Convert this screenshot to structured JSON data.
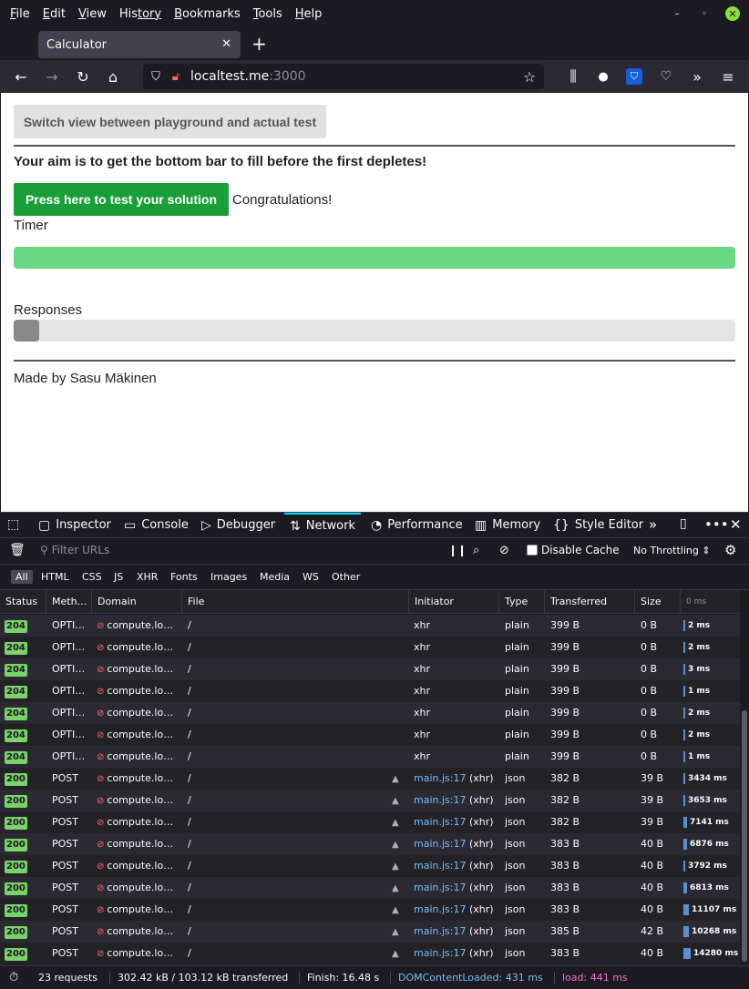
{
  "menubar": {
    "items": [
      {
        "first": "F",
        "rest": "ile"
      },
      {
        "first": "E",
        "rest": "dit"
      },
      {
        "first": "V",
        "rest": "iew"
      },
      {
        "first": "His",
        "rest": "tory",
        "underline_index": 3
      },
      {
        "first": "B",
        "rest": "ookmarks"
      },
      {
        "first": "T",
        "rest": "ools"
      },
      {
        "first": "H",
        "rest": "elp"
      }
    ]
  },
  "tab": {
    "title": "Calculator"
  },
  "urlbar": {
    "host": "localtest.me",
    "port": ":3000"
  },
  "page": {
    "switch_button": "Switch view between playground and actual test",
    "aim": "Your aim is to get the bottom bar to fill before the first depletes!",
    "test_button": "Press here to test your solution",
    "result": "Congratulations!",
    "timer_label": "Timer",
    "timer_progress": 1.0,
    "responses_label": "Responses",
    "responses_progress": 0.035,
    "made_by": "Made by Sasu Mäkinen",
    "colors": {
      "test_button": "#1a9e3a",
      "timer_fill": "#69d882",
      "responses_fill": "#888888"
    }
  },
  "devtools": {
    "tabs": [
      "Inspector",
      "Console",
      "Debugger",
      "Network",
      "Performance",
      "Memory",
      "Style Editor"
    ],
    "active_tab": "Network",
    "toolbar": {
      "filter_placeholder": "Filter URLs",
      "disable_cache": "Disable Cache",
      "throttling": "No Throttling"
    },
    "type_filters": [
      "All",
      "HTML",
      "CSS",
      "JS",
      "XHR",
      "Fonts",
      "Images",
      "Media",
      "WS",
      "Other"
    ],
    "columns": [
      "Status",
      "Meth…",
      "Domain",
      "File",
      "Initiator",
      "Type",
      "Transferred",
      "Size",
      "0 ms"
    ],
    "requests": [
      {
        "status": "204",
        "method": "OPTI…",
        "domain": "compute.lo…",
        "file": "/",
        "initiator": "xhr",
        "initiator_link": false,
        "type": "plain",
        "transferred": "399 B",
        "size": "0 B",
        "time": "2 ms",
        "time_ms": 2
      },
      {
        "status": "204",
        "method": "OPTI…",
        "domain": "compute.lo…",
        "file": "/",
        "initiator": "xhr",
        "initiator_link": false,
        "type": "plain",
        "transferred": "399 B",
        "size": "0 B",
        "time": "2 ms",
        "time_ms": 2
      },
      {
        "status": "204",
        "method": "OPTI…",
        "domain": "compute.lo…",
        "file": "/",
        "initiator": "xhr",
        "initiator_link": false,
        "type": "plain",
        "transferred": "399 B",
        "size": "0 B",
        "time": "3 ms",
        "time_ms": 3
      },
      {
        "status": "204",
        "method": "OPTI…",
        "domain": "compute.lo…",
        "file": "/",
        "initiator": "xhr",
        "initiator_link": false,
        "type": "plain",
        "transferred": "399 B",
        "size": "0 B",
        "time": "1 ms",
        "time_ms": 1
      },
      {
        "status": "204",
        "method": "OPTI…",
        "domain": "compute.lo…",
        "file": "/",
        "initiator": "xhr",
        "initiator_link": false,
        "type": "plain",
        "transferred": "399 B",
        "size": "0 B",
        "time": "2 ms",
        "time_ms": 2
      },
      {
        "status": "204",
        "method": "OPTI…",
        "domain": "compute.lo…",
        "file": "/",
        "initiator": "xhr",
        "initiator_link": false,
        "type": "plain",
        "transferred": "399 B",
        "size": "0 B",
        "time": "2 ms",
        "time_ms": 2
      },
      {
        "status": "204",
        "method": "OPTI…",
        "domain": "compute.lo…",
        "file": "/",
        "initiator": "xhr",
        "initiator_link": false,
        "type": "plain",
        "transferred": "399 B",
        "size": "0 B",
        "time": "1 ms",
        "time_ms": 1
      },
      {
        "status": "200",
        "method": "POST",
        "domain": "compute.lo…",
        "file": "/",
        "initiator": "main.js:17",
        "initiator_suffix": " (xhr)",
        "initiator_link": true,
        "type": "json",
        "transferred": "382 B",
        "size": "39 B",
        "time": "3434 ms",
        "time_ms": 3434
      },
      {
        "status": "200",
        "method": "POST",
        "domain": "compute.lo…",
        "file": "/",
        "initiator": "main.js:17",
        "initiator_suffix": " (xhr)",
        "initiator_link": true,
        "type": "json",
        "transferred": "382 B",
        "size": "39 B",
        "time": "3653 ms",
        "time_ms": 3653
      },
      {
        "status": "200",
        "method": "POST",
        "domain": "compute.lo…",
        "file": "/",
        "initiator": "main.js:17",
        "initiator_suffix": " (xhr)",
        "initiator_link": true,
        "type": "json",
        "transferred": "382 B",
        "size": "39 B",
        "time": "7141 ms",
        "time_ms": 7141
      },
      {
        "status": "200",
        "method": "POST",
        "domain": "compute.lo…",
        "file": "/",
        "initiator": "main.js:17",
        "initiator_suffix": " (xhr)",
        "initiator_link": true,
        "type": "json",
        "transferred": "383 B",
        "size": "40 B",
        "time": "6876 ms",
        "time_ms": 6876
      },
      {
        "status": "200",
        "method": "POST",
        "domain": "compute.lo…",
        "file": "/",
        "initiator": "main.js:17",
        "initiator_suffix": " (xhr)",
        "initiator_link": true,
        "type": "json",
        "transferred": "383 B",
        "size": "40 B",
        "time": "3792 ms",
        "time_ms": 3792
      },
      {
        "status": "200",
        "method": "POST",
        "domain": "compute.lo…",
        "file": "/",
        "initiator": "main.js:17",
        "initiator_suffix": " (xhr)",
        "initiator_link": true,
        "type": "json",
        "transferred": "383 B",
        "size": "40 B",
        "time": "6813 ms",
        "time_ms": 6813
      },
      {
        "status": "200",
        "method": "POST",
        "domain": "compute.lo…",
        "file": "/",
        "initiator": "main.js:17",
        "initiator_suffix": " (xhr)",
        "initiator_link": true,
        "type": "json",
        "transferred": "383 B",
        "size": "40 B",
        "time": "11107 ms",
        "time_ms": 11107
      },
      {
        "status": "200",
        "method": "POST",
        "domain": "compute.lo…",
        "file": "/",
        "initiator": "main.js:17",
        "initiator_suffix": " (xhr)",
        "initiator_link": true,
        "type": "json",
        "transferred": "385 B",
        "size": "42 B",
        "time": "10268 ms",
        "time_ms": 10268
      },
      {
        "status": "200",
        "method": "POST",
        "domain": "compute.lo…",
        "file": "/",
        "initiator": "main.js:17",
        "initiator_suffix": " (xhr)",
        "initiator_link": true,
        "type": "json",
        "transferred": "383 B",
        "size": "40 B",
        "time": "14280 ms",
        "time_ms": 14280
      }
    ],
    "statusbar": {
      "requests": "23 requests",
      "transferred": "302.42 kB / 103.12 kB transferred",
      "finish": "Finish: 16.48 s",
      "dom_content_loaded": "DOMContentLoaded: 431 ms",
      "load": "load: 441 ms"
    }
  }
}
